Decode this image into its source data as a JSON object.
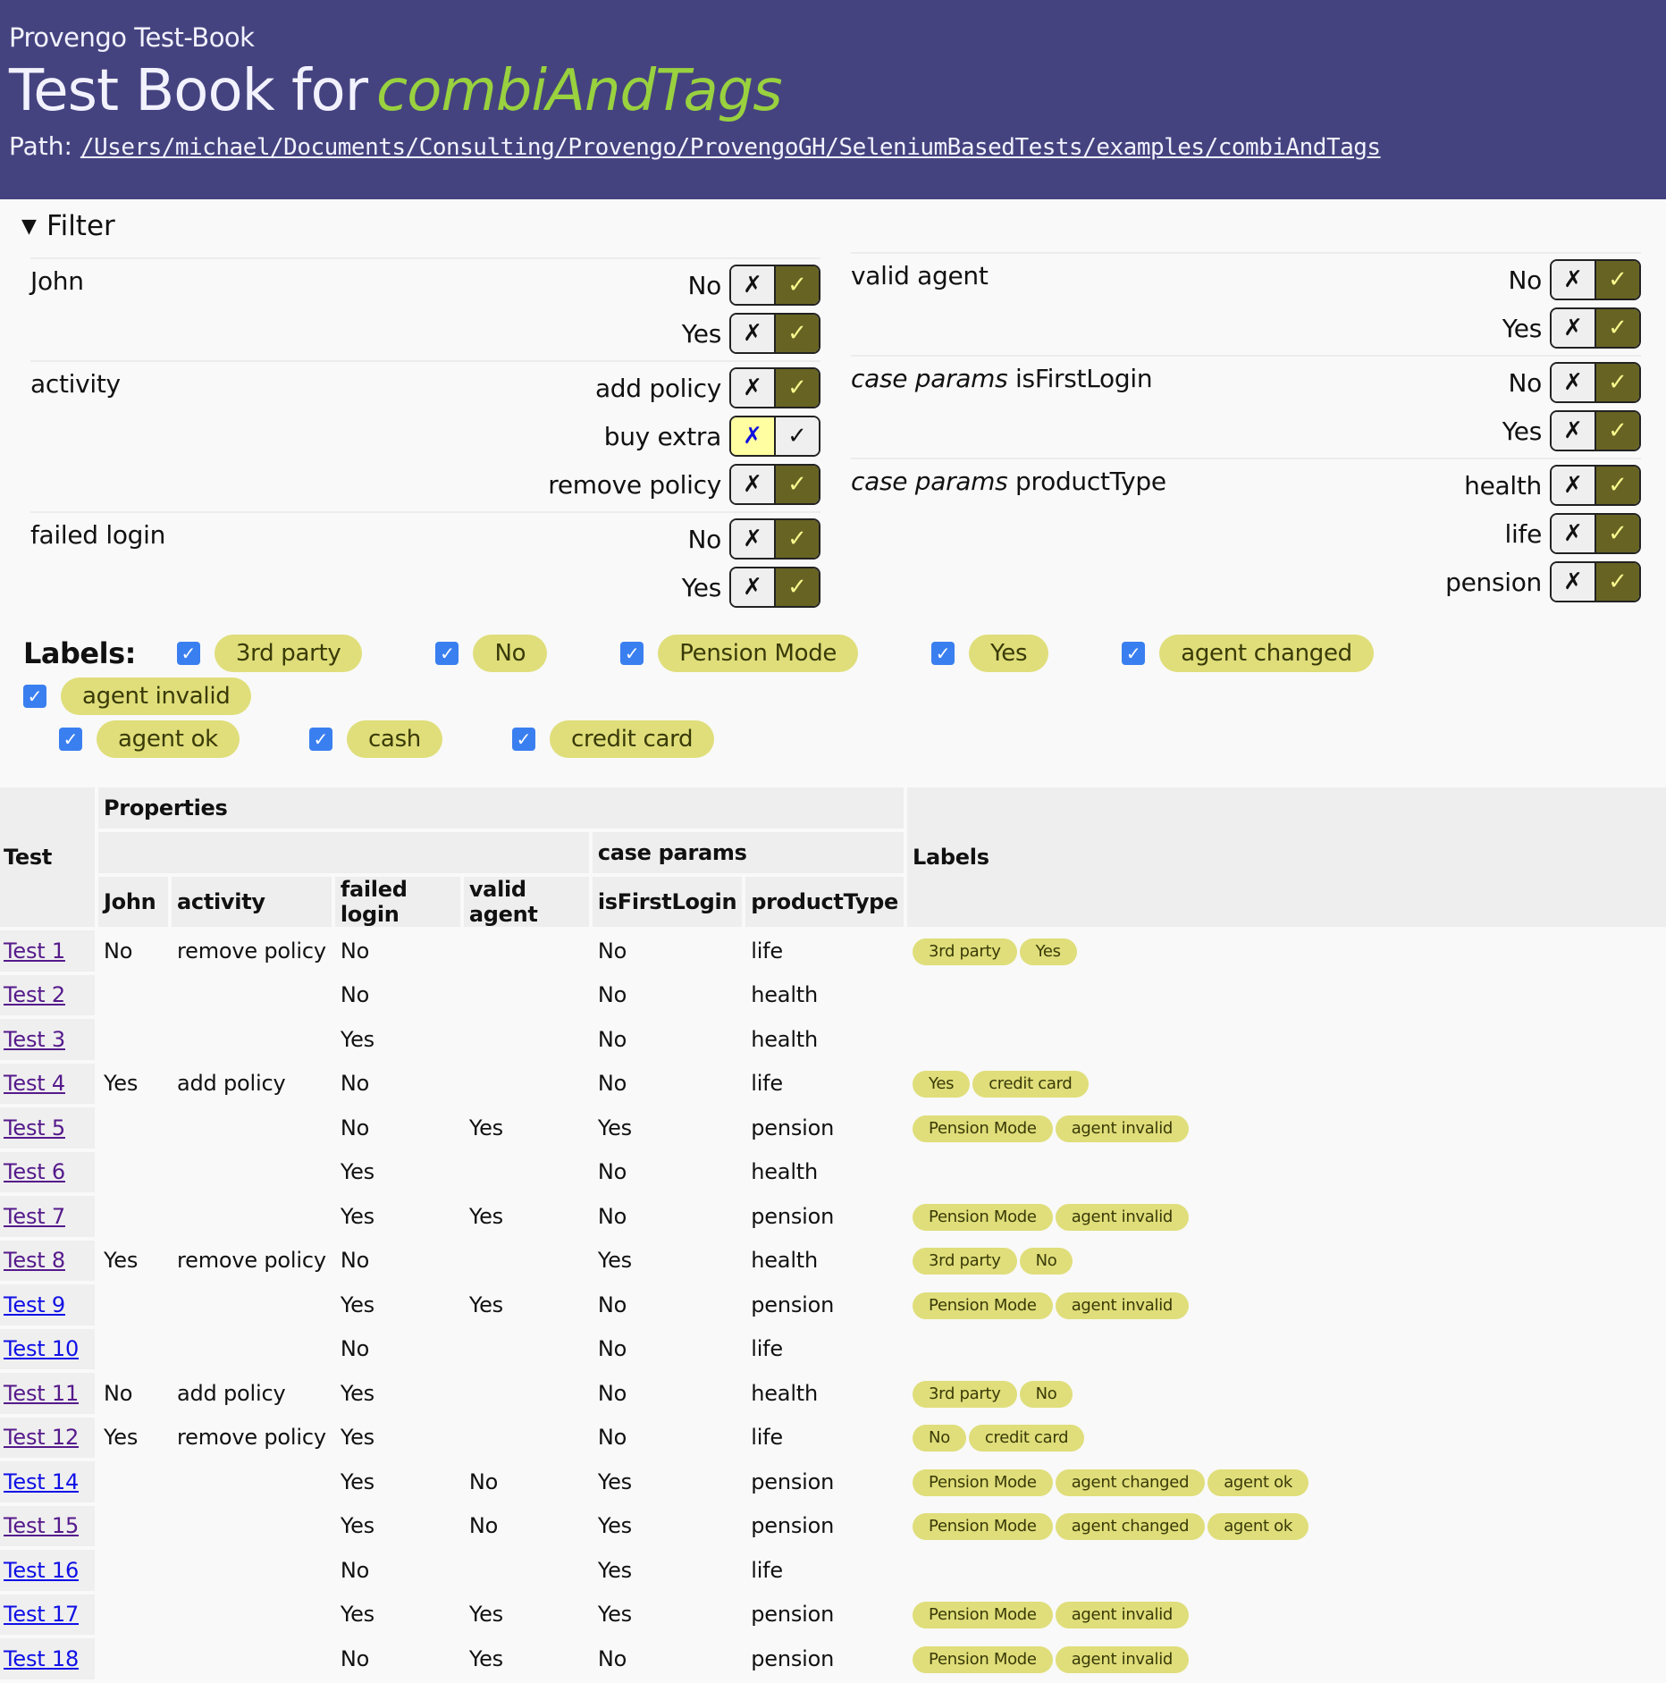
{
  "header": {
    "subtitle": "Provengo Test-Book",
    "title_prefix": "Test Book for",
    "title_name": "combiAndTags",
    "path_label": "Path:",
    "path_value": "/Users/michael/Documents/Consulting/Provengo/ProvengoGH/SeleniumBasedTests/examples/combiAndTags"
  },
  "filter": {
    "summary": "Filter",
    "left_groups": [
      {
        "title": "John",
        "values": [
          {
            "label": "No",
            "excluded": false
          },
          {
            "label": "Yes",
            "excluded": false
          }
        ]
      },
      {
        "title": "activity",
        "values": [
          {
            "label": "add policy",
            "excluded": false
          },
          {
            "label": "buy extra",
            "excluded": true
          },
          {
            "label": "remove policy",
            "excluded": false
          }
        ]
      },
      {
        "title": "failed login",
        "values": [
          {
            "label": "No",
            "excluded": false
          },
          {
            "label": "Yes",
            "excluded": false
          }
        ]
      }
    ],
    "right_groups": [
      {
        "prefix": "",
        "title": "valid agent",
        "values": [
          {
            "label": "No",
            "excluded": false
          },
          {
            "label": "Yes",
            "excluded": false
          }
        ]
      },
      {
        "prefix": "case params",
        "title": "isFirstLogin",
        "values": [
          {
            "label": "No",
            "excluded": false
          },
          {
            "label": "Yes",
            "excluded": false
          }
        ]
      },
      {
        "prefix": "case params",
        "title": "productType",
        "values": [
          {
            "label": "health",
            "excluded": false
          },
          {
            "label": "life",
            "excluded": false
          },
          {
            "label": "pension",
            "excluded": false
          }
        ]
      }
    ],
    "exclude_glyph": "✗",
    "include_glyph": "✓"
  },
  "labels": {
    "title": "Labels:",
    "items": [
      {
        "label": "3rd party",
        "checked": true
      },
      {
        "label": "No",
        "checked": true
      },
      {
        "label": "Pension Mode",
        "checked": true
      },
      {
        "label": "Yes",
        "checked": true
      },
      {
        "label": "agent changed",
        "checked": true
      },
      {
        "label": "agent invalid",
        "checked": true
      },
      {
        "label": "agent ok",
        "checked": true
      },
      {
        "label": "cash",
        "checked": true
      },
      {
        "label": "credit card",
        "checked": true
      }
    ]
  },
  "table": {
    "headers": {
      "test": "Test",
      "properties": "Properties",
      "case_params": "case params",
      "labels": "Labels",
      "columns": [
        "John",
        "activity",
        "failed login",
        "valid agent",
        "isFirstLogin",
        "productType"
      ]
    },
    "rows": [
      {
        "test": "Test 1",
        "visited": true,
        "john": "No",
        "activity": "remove policy",
        "failed_login": "No",
        "valid_agent": "",
        "is_first_login": "No",
        "product_type": "life",
        "labels": [
          "3rd party",
          "Yes"
        ]
      },
      {
        "test": "Test 2",
        "visited": true,
        "john": "",
        "activity": "",
        "failed_login": "No",
        "valid_agent": "",
        "is_first_login": "No",
        "product_type": "health",
        "labels": []
      },
      {
        "test": "Test 3",
        "visited": true,
        "john": "",
        "activity": "",
        "failed_login": "Yes",
        "valid_agent": "",
        "is_first_login": "No",
        "product_type": "health",
        "labels": []
      },
      {
        "test": "Test 4",
        "visited": true,
        "john": "Yes",
        "activity": "add policy",
        "failed_login": "No",
        "valid_agent": "",
        "is_first_login": "No",
        "product_type": "life",
        "labels": [
          "Yes",
          "credit card"
        ]
      },
      {
        "test": "Test 5",
        "visited": true,
        "john": "",
        "activity": "",
        "failed_login": "No",
        "valid_agent": "Yes",
        "is_first_login": "Yes",
        "product_type": "pension",
        "labels": [
          "Pension Mode",
          "agent invalid"
        ]
      },
      {
        "test": "Test 6",
        "visited": true,
        "john": "",
        "activity": "",
        "failed_login": "Yes",
        "valid_agent": "",
        "is_first_login": "No",
        "product_type": "health",
        "labels": []
      },
      {
        "test": "Test 7",
        "visited": true,
        "john": "",
        "activity": "",
        "failed_login": "Yes",
        "valid_agent": "Yes",
        "is_first_login": "No",
        "product_type": "pension",
        "labels": [
          "Pension Mode",
          "agent invalid"
        ]
      },
      {
        "test": "Test 8",
        "visited": true,
        "john": "Yes",
        "activity": "remove policy",
        "failed_login": "No",
        "valid_agent": "",
        "is_first_login": "Yes",
        "product_type": "health",
        "labels": [
          "3rd party",
          "No"
        ]
      },
      {
        "test": "Test 9",
        "visited": false,
        "john": "",
        "activity": "",
        "failed_login": "Yes",
        "valid_agent": "Yes",
        "is_first_login": "No",
        "product_type": "pension",
        "labels": [
          "Pension Mode",
          "agent invalid"
        ]
      },
      {
        "test": "Test 10",
        "visited": false,
        "john": "",
        "activity": "",
        "failed_login": "No",
        "valid_agent": "",
        "is_first_login": "No",
        "product_type": "life",
        "labels": []
      },
      {
        "test": "Test 11",
        "visited": true,
        "john": "No",
        "activity": "add policy",
        "failed_login": "Yes",
        "valid_agent": "",
        "is_first_login": "No",
        "product_type": "health",
        "labels": [
          "3rd party",
          "No"
        ]
      },
      {
        "test": "Test 12",
        "visited": true,
        "john": "Yes",
        "activity": "remove policy",
        "failed_login": "Yes",
        "valid_agent": "",
        "is_first_login": "No",
        "product_type": "life",
        "labels": [
          "No",
          "credit card"
        ]
      },
      {
        "test": "Test 14",
        "visited": false,
        "john": "",
        "activity": "",
        "failed_login": "Yes",
        "valid_agent": "No",
        "is_first_login": "Yes",
        "product_type": "pension",
        "labels": [
          "Pension Mode",
          "agent changed",
          "agent ok"
        ]
      },
      {
        "test": "Test 15",
        "visited": true,
        "john": "",
        "activity": "",
        "failed_login": "Yes",
        "valid_agent": "No",
        "is_first_login": "Yes",
        "product_type": "pension",
        "labels": [
          "Pension Mode",
          "agent changed",
          "agent ok"
        ]
      },
      {
        "test": "Test 16",
        "visited": false,
        "john": "",
        "activity": "",
        "failed_login": "No",
        "valid_agent": "",
        "is_first_login": "Yes",
        "product_type": "life",
        "labels": []
      },
      {
        "test": "Test 17",
        "visited": false,
        "john": "",
        "activity": "",
        "failed_login": "Yes",
        "valid_agent": "Yes",
        "is_first_login": "Yes",
        "product_type": "pension",
        "labels": [
          "Pension Mode",
          "agent invalid"
        ]
      },
      {
        "test": "Test 18",
        "visited": false,
        "john": "",
        "activity": "",
        "failed_login": "No",
        "valid_agent": "Yes",
        "is_first_login": "No",
        "product_type": "pension",
        "labels": [
          "Pension Mode",
          "agent invalid"
        ]
      }
    ]
  },
  "colors": {
    "header_bg": "#45437f",
    "title_accent": "#99d13f",
    "chip_bg": "#dfde7a",
    "toggle_on_bg": "#676323",
    "toggle_excluded_bg": "#fffea0",
    "checkbox": "#3a7ff0",
    "link": "#1010e6",
    "link_visited": "#551a8b"
  }
}
